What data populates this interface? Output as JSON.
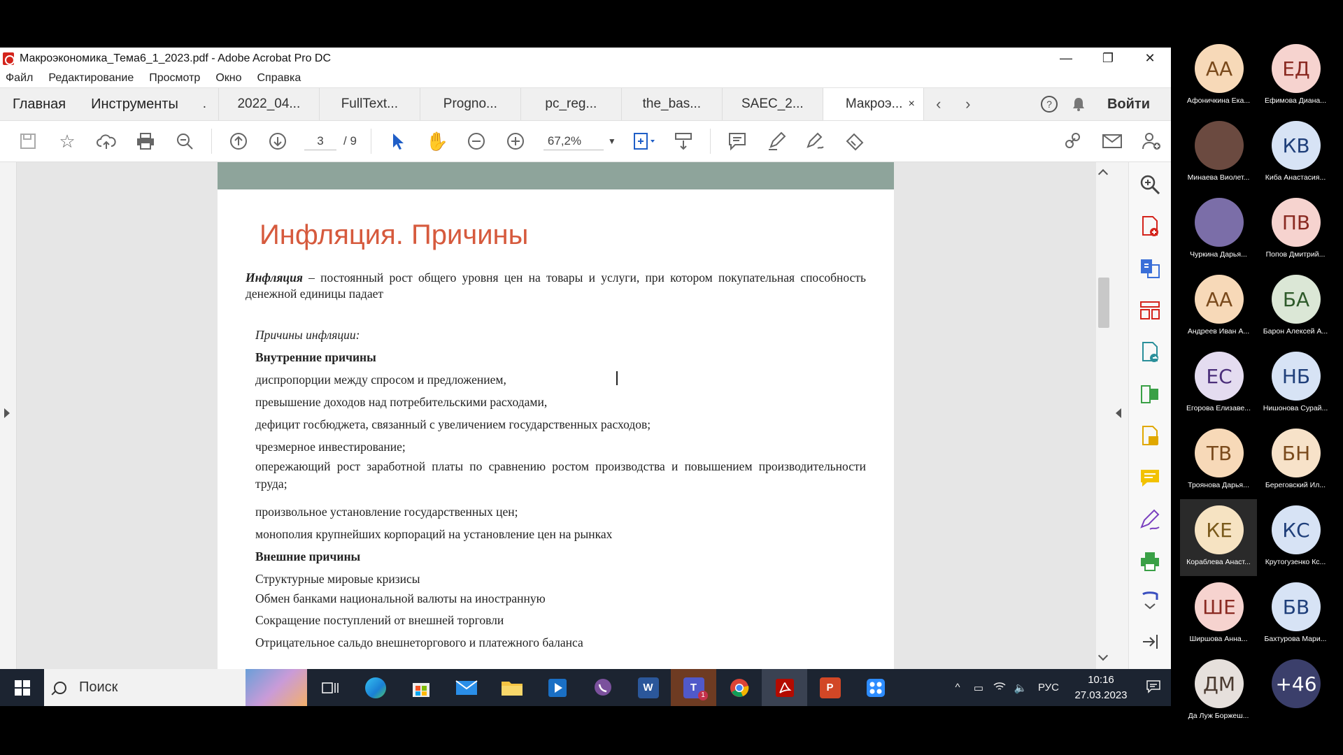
{
  "window": {
    "title": "Макроэкономика_Тема6_1_2023.pdf - Adobe Acrobat Pro DC",
    "controls": {
      "minimize": "—",
      "restore": "❐",
      "close": "✕"
    }
  },
  "menu": [
    "Файл",
    "Редактирование",
    "Просмотр",
    "Окно",
    "Справка"
  ],
  "tabs": {
    "home": "Главная",
    "tools": "Инструменты",
    "hidden": ".",
    "docs": [
      "2022_04...",
      "FullText...",
      "Progno...",
      "pc_reg...",
      "the_bas...",
      "SAEC_2..."
    ],
    "active": "Макроэ...",
    "active_close": "×",
    "login": "Войти"
  },
  "toolbar": {
    "page_current": "3",
    "page_total": "/ 9",
    "zoom": "67,2%"
  },
  "document": {
    "title": "Инфляция. Причины",
    "definition_term": "Инфляция",
    "definition_text": " – постоянный рост общего уровня  цен на товары и услуги, при котором покупательная способность денежной единицы падает",
    "causes_heading": "Причины инфляции:",
    "internal_heading": "Внутренние причины",
    "internal": [
      "диспропорции между спросом и предложением,",
      "превышение доходов над потребительскими расходами,",
      "дефицит госбюджета, связанный с увеличением государственных расходов;",
      "чрезмерное инвестирование;",
      "опережающий рост заработной платы по сравнению ростом производства и повышением производительности труда;",
      "произвольное установление государственных цен;",
      "монополия крупнейших корпораций на установление цен на рынках"
    ],
    "external_heading": "Внешние причины",
    "external": [
      "Структурные  мировые кризисы",
      "Обмен банками национальной валюты на иностранную",
      "Сокращение поступлений от внешней торговли",
      "Отрицательное сальдо внешнеторгового и платежного баланса"
    ]
  },
  "taskbar": {
    "search_placeholder": "Поиск",
    "language": "РУС",
    "time": "10:16",
    "date": "27.03.2023",
    "teams_badge": "1"
  },
  "participants": [
    {
      "initials": "АА",
      "name": "Афоничкина Ека...",
      "bg": "#f7d9b8",
      "fg": "#7a4a1c"
    },
    {
      "initials": "ЕД",
      "name": "Ефимова Диана...",
      "bg": "#f6d3cf",
      "fg": "#8a2a22"
    },
    {
      "initials": "",
      "name": "Минаева Виолет...",
      "bg": "#6b4a40",
      "fg": "#fff"
    },
    {
      "initials": "КВ",
      "name": "Киба Анастасия...",
      "bg": "#d7e3f5",
      "fg": "#1f3f7a"
    },
    {
      "initials": "",
      "name": "Чуркина Дарья...",
      "bg": "#7b6ea8",
      "fg": "#fff"
    },
    {
      "initials": "ПВ",
      "name": "Попов Дмитрий...",
      "bg": "#f6d3cf",
      "fg": "#8a2a22"
    },
    {
      "initials": "АА",
      "name": "Андреев Иван А...",
      "bg": "#f7d9b8",
      "fg": "#7a4a1c"
    },
    {
      "initials": "БА",
      "name": "Барон Алексей А...",
      "bg": "#dbe7d6",
      "fg": "#2e5a2a"
    },
    {
      "initials": "ЕС",
      "name": "Егорова Елизаве...",
      "bg": "#e4dcf0",
      "fg": "#4b2f7a"
    },
    {
      "initials": "НБ",
      "name": "Нишонова Сурай...",
      "bg": "#d7e3f5",
      "fg": "#1f3f7a"
    },
    {
      "initials": "ТВ",
      "name": "Троянова Дарья...",
      "bg": "#f7d9b8",
      "fg": "#7a4a1c"
    },
    {
      "initials": "БН",
      "name": "Береговский Ил...",
      "bg": "#f7e2c9",
      "fg": "#7a4a1c"
    },
    {
      "initials": "КЕ",
      "name": "Кораблева Анаст...",
      "bg": "#f6e3c2",
      "fg": "#7a5a1c"
    },
    {
      "initials": "КС",
      "name": "Крутогузенко Кс...",
      "bg": "#d7e3f5",
      "fg": "#1f3f7a"
    },
    {
      "initials": "ШЕ",
      "name": "Ширшова Анна...",
      "bg": "#f6d3cf",
      "fg": "#8a2a22"
    },
    {
      "initials": "БВ",
      "name": "Бахтурова Мари...",
      "bg": "#d7e3f5",
      "fg": "#1f3f7a"
    },
    {
      "initials": "ДМ",
      "name": "Да Луж Боржеш...",
      "bg": "#e6e0dc",
      "fg": "#4a3a30"
    },
    {
      "initials": "+46",
      "name": "",
      "bg": "#3b3f6b",
      "fg": "#fff"
    }
  ],
  "colors": {
    "accent": "#d65a3d",
    "band": "#8ea49b",
    "taskbar": "#1c2431",
    "acrobat_red": "#d4241c"
  }
}
